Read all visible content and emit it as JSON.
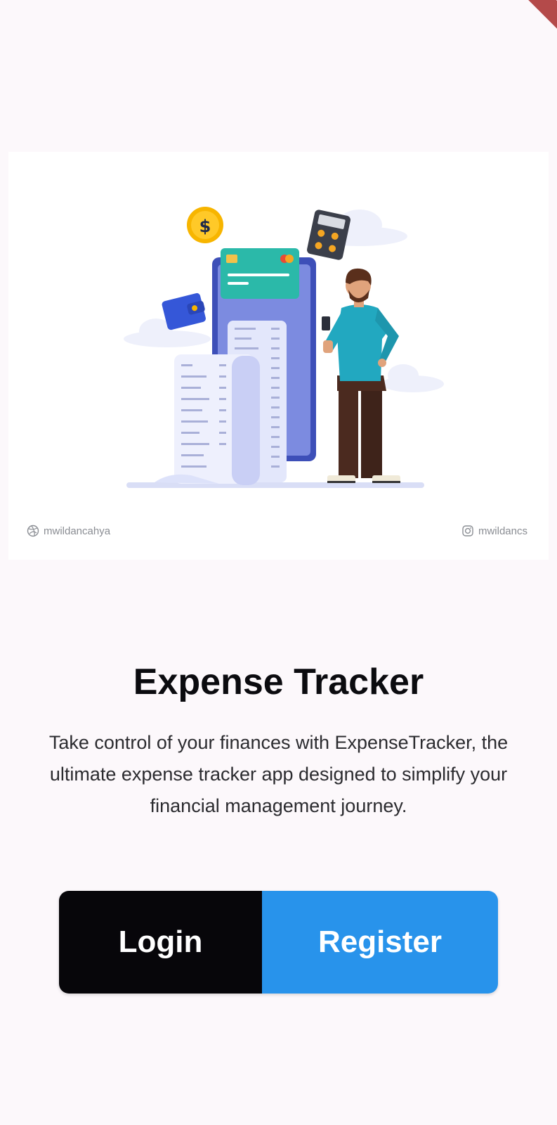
{
  "illustration": {
    "credit_left": "mwildancahya",
    "credit_right": "mwildancs",
    "credit_left_icon": "dribbble-icon",
    "credit_right_icon": "instagram-icon"
  },
  "hero": {
    "title": "Expense Tracker",
    "description": "Take control of your finances with ExpenseTracker, the ultimate expense tracker app designed to simplify your financial management journey."
  },
  "actions": {
    "login_label": "Login",
    "register_label": "Register"
  },
  "colors": {
    "background": "#fcf8fb",
    "login_button": "#07060a",
    "register_button": "#2893eb",
    "debug_banner": "#b44a4a"
  }
}
